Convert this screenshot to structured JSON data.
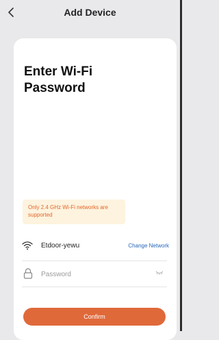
{
  "header": {
    "title": "Add Device",
    "back_icon": "chevron-left-icon"
  },
  "main": {
    "heading": "Enter Wi-Fi\nPassword",
    "notice": "Only 2.4 GHz Wi-Fi networks are supported",
    "network": {
      "icon": "wifi-icon",
      "name": "Etdoor-yewu",
      "change_label": "Change Network"
    },
    "password": {
      "icon": "lock-icon",
      "placeholder": "Password",
      "value": "",
      "toggle_icon": "eye-closed-icon"
    },
    "confirm_label": "Confirm"
  },
  "colors": {
    "background": "#e9e9ec",
    "card": "#ffffff",
    "accent": "#e0693a",
    "notice_bg": "#fdf3de",
    "notice_text": "#e3662a",
    "link": "#2566b8"
  }
}
